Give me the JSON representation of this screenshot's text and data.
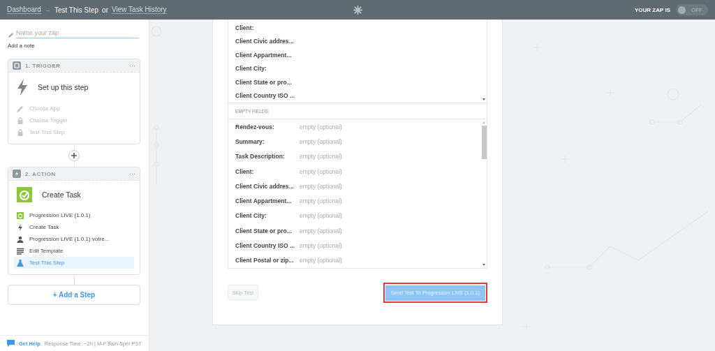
{
  "breadcrumb": {
    "dashboard": "Dashboard",
    "separator": "→",
    "current": "Test This Step",
    "or": "or",
    "history": "View Task History"
  },
  "zap_status": {
    "label": "YOUR ZAP IS",
    "on": false,
    "state_text": "OFF"
  },
  "sidebar": {
    "name_placeholder": "Name your zap",
    "add_note": "Add a note",
    "steps": [
      {
        "header": "1. TRIGGER",
        "kind": "trigger",
        "more": "···",
        "title": "Set up this step",
        "items": [
          {
            "label": "Choose App",
            "disabled": true,
            "selected": false
          },
          {
            "label": "Choose Trigger",
            "disabled": true,
            "selected": false
          },
          {
            "label": "Test This Step",
            "disabled": true,
            "selected": false
          }
        ]
      },
      {
        "header": "2. ACTION",
        "kind": "action",
        "more": "···",
        "title": "Create Task",
        "items": [
          {
            "label": "Progression LIVE (1.0.1)",
            "disabled": false,
            "selected": false
          },
          {
            "label": "Create Task",
            "disabled": false,
            "selected": false
          },
          {
            "label": "Progression LIVE (1.0.1) votre...",
            "disabled": false,
            "selected": false
          },
          {
            "label": "Edit Template",
            "disabled": false,
            "selected": false
          },
          {
            "label": "Test This Step",
            "disabled": false,
            "selected": true
          }
        ]
      }
    ],
    "add_step": "+ Add a Step",
    "help": {
      "link": "Get Help",
      "text": "Response Time: ~2h | M-F 9am-5pm PST"
    }
  },
  "filled_fields": [
    "Client:",
    "Client Civic addres...",
    "Client Appartment...",
    "Client City:",
    "Client State or pro...",
    "Client Country ISO ..."
  ],
  "empty_fields_heading": "EMPTY FIELDS:",
  "empty_fields": [
    {
      "label": "Rendez-vous:",
      "value": "empty (optional)"
    },
    {
      "label": "Summary:",
      "value": "empty (optional)"
    },
    {
      "label": "Task Description:",
      "value": "empty (optional)"
    },
    {
      "label": "Client:",
      "value": "empty (optional)"
    },
    {
      "label": "Client Civic addres...",
      "value": "empty (optional)"
    },
    {
      "label": "Client Appartment...",
      "value": "empty (optional)"
    },
    {
      "label": "Client City:",
      "value": "empty (optional)"
    },
    {
      "label": "Client State or pro...",
      "value": "empty (optional)"
    },
    {
      "label": "Client Country ISO ...",
      "value": "empty (optional)"
    },
    {
      "label": "Client Postal or zip...",
      "value": "empty (optional)"
    }
  ],
  "buttons": {
    "skip": "Skip Test",
    "send": "Send Test To Progression LIVE (1.0.1)"
  }
}
